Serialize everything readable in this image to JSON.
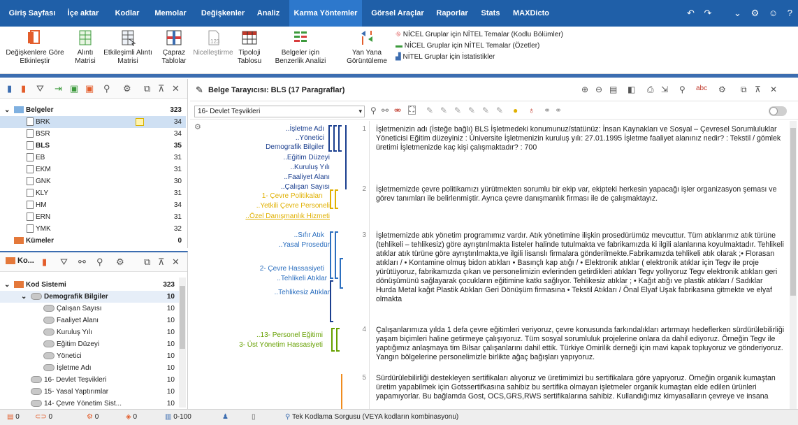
{
  "menu": {
    "tabs": [
      "Giriş Sayfası",
      "İçe aktar",
      "Kodlar",
      "Memolar",
      "Değişkenler",
      "Analiz",
      "Karma Yöntemler",
      "Görsel Araçlar",
      "Raporlar",
      "Stats",
      "MAXDicto"
    ],
    "active_index": 6
  },
  "ribbon": {
    "buttons": [
      {
        "label1": "Değişkenlere Göre",
        "label2": "Etkinleştir",
        "icon": "activate-by-variables-icon"
      },
      {
        "label1": "Alıntı",
        "label2": "Matrisi",
        "icon": "quote-matrix-icon"
      },
      {
        "label1": "Etkileşimli Alıntı",
        "label2": "Matrisi",
        "icon": "interactive-quote-matrix-icon"
      },
      {
        "label1": "Çapraz",
        "label2": "Tablolar",
        "icon": "crosstab-icon"
      },
      {
        "label1": "Nicelleştirme",
        "label2": "",
        "icon": "quantitize-icon"
      },
      {
        "label1": "Tipoloji",
        "label2": "Tablosu",
        "icon": "typology-table-icon"
      },
      {
        "label1": "Belgeler için",
        "label2": "Benzerlik Analizi",
        "icon": "similarity-analysis-icon"
      },
      {
        "label1": "Yan Yana",
        "label2": "Görüntüleme",
        "icon": "side-by-side-icon"
      }
    ],
    "list": [
      "NİCEL Gruplar için NİTEL Temalar (Kodlu Bölümler)",
      "NİCEL Gruplar için NİTEL Temalar (Özetler)",
      "NİTEL Gruplar için İstatistikler"
    ]
  },
  "documents": {
    "root": {
      "label": "Belgeler",
      "count": "323"
    },
    "items": [
      {
        "label": "BRK",
        "count": "34",
        "selected": true
      },
      {
        "label": "BSR",
        "count": "34"
      },
      {
        "label": "BLS",
        "count": "35",
        "bold": true
      },
      {
        "label": "EB",
        "count": "31"
      },
      {
        "label": "EKM",
        "count": "31"
      },
      {
        "label": "GNK",
        "count": "30"
      },
      {
        "label": "KLY",
        "count": "31"
      },
      {
        "label": "HM",
        "count": "34"
      },
      {
        "label": "ERN",
        "count": "31"
      },
      {
        "label": "YMK",
        "count": "32"
      }
    ],
    "sets": {
      "label": "Kümeler",
      "count": "0"
    }
  },
  "codes": {
    "toolbar_title": "Ko...",
    "root": {
      "label": "Kod Sistemi",
      "count": "323"
    },
    "items": [
      {
        "label": "Demografik Bilgiler",
        "count": "10",
        "level": 1,
        "bold": true
      },
      {
        "label": "Çalışan Sayısı",
        "count": "10",
        "level": 2
      },
      {
        "label": "Faaliyet Alanı",
        "count": "10",
        "level": 2
      },
      {
        "label": "Kuruluş Yılı",
        "count": "10",
        "level": 2
      },
      {
        "label": "Eğitim Düzeyi",
        "count": "10",
        "level": 2
      },
      {
        "label": "Yönetici",
        "count": "10",
        "level": 2
      },
      {
        "label": "İşletme Adı",
        "count": "10",
        "level": 2
      },
      {
        "label": "16- Devlet Teşvikleri",
        "count": "10",
        "level": 1
      },
      {
        "label": "15- Yasal Yaptırımlar",
        "count": "10",
        "level": 1
      },
      {
        "label": "14- Çevre Yönetim Sist...",
        "count": "10",
        "level": 1
      }
    ]
  },
  "browser": {
    "title": "Belge Tarayıcısı: BLS  (17 Paragraflar)",
    "select_value": "16- Devlet Teşvikleri",
    "code_labels": [
      {
        "text": "..İşletme Adı",
        "color": "#1b3f8f"
      },
      {
        "text": "..Yönetici",
        "color": "#1b3f8f"
      },
      {
        "text": "Demografik Bilgiler",
        "color": "#1b3f8f"
      },
      {
        "text": "..Eğitim Düzeyi",
        "color": "#1b3f8f"
      },
      {
        "text": "..Kuruluş Yılı",
        "color": "#1b3f8f"
      },
      {
        "text": "..Faaliyet Alanı",
        "color": "#1b3f8f"
      },
      {
        "text": "..Çalışan Sayısı",
        "color": "#1b3f8f"
      },
      {
        "text": "1- Çevre Politikaları",
        "color": "#e0b000"
      },
      {
        "text": "..Yetkili Çevre Personeli",
        "color": "#e0b000"
      },
      {
        "text": "..Özel Danışmanlık Hizmeti",
        "color": "#e0b000"
      },
      {
        "text": "..Sıfır Atık",
        "color": "#2c6fbf"
      },
      {
        "text": "..Yasal Prosedür",
        "color": "#2c6fbf"
      },
      {
        "text": "2- Çevre Hassasiyeti",
        "color": "#2c6fbf"
      },
      {
        "text": "..Tehlikeli Atıklar",
        "color": "#2c6fbf"
      },
      {
        "text": "..Tehlikesiz Atıklar",
        "color": "#2c6fbf"
      },
      {
        "text": "..13- Personel Eğitimi",
        "color": "#66a000"
      },
      {
        "text": "3- Üst Yönetim Hassasiyeti",
        "color": "#66a000"
      }
    ],
    "paragraphs": [
      {
        "num": "1",
        "text": " İşletmenizin adı (İsteğe bağlı) BLS İşletmedeki konumunuz/statünüz: İnsan Kaynakları ve Sosyal – Çevresel Sorumluluklar Yöneticisi Eğitim düzeyiniz : Üniversite İşletmenizin kuruluş yılı: 27.01.1995 İşletme faaliyet alanınız nedir? : Tekstil / gömlek üretimi İşletmenizde kaç kişi çalışmaktadır? : 700"
      },
      {
        "num": "2",
        "text": "İşletmemizde çevre politikamızı yürütmekten sorumlu bir ekip var, ekipteki herkesin yapacağı işler organizasyon şeması ve görev tanımları ile belirlenmiştir. Ayrıca çevre danışmanlık firması ile de çalışmaktayız."
      },
      {
        "num": "3",
        "text": "İşletmemizde atık yönetim programımız vardır. Atık yönetimine ilişkin prosedürümüz mevcuttur. Tüm atıklarımız atık türüne (tehlikeli – tehlikesiz) göre ayrıştırılmakta  listeler halinde tutulmakta ve fabrikamızda ki ilgili alanlarına koyulmaktadır. Tehlikeli atıklar atık türüne göre ayrıştırılmakta,ve ilgili lisanslı firmalara gönderilmekte.Fabrikamızda tehlikeli atık olarak ;• Florasan atıkları /  • Kontamine olmuş bidon atıkları   • Basınçlı kap atığı / • Elektronik atıklar ( elektronik atıklar için Tegv ile proje yürütüyoruz, fabrikamızda çıkan ve personelimizin evlerinden getirdikleri atıkları Tegv yollıyoruz Tegv elektronik atıkları geri dönüşümünü sağlayarak çocukların eğitimine katkı sağlıyor. Tehlikesiz atıklar ; •       Kağıt atığı ve plastik atıkları / Sadıklar Hurda Metal kağıt Plastik Atıkları Geri Dönüşüm firmasına • Tekstil Atıkları / Önal Elyaf Uşak fabrikasına gitmekte ve elyaf olmakta"
      },
      {
        "num": "4",
        "text": " Çalışanlarımıza yılda 1 defa çevre eğitimleri veriyoruz, çevre konusunda farkındalıkları artırmayı hedeflerken sürdürülebilirliği yaşam biçimleri haline getirmeye çalışıyoruz. Tüm sosyal sorumluluk projelerine onlara da dahil ediyoruz. Örneğin Tegv ile yaptığımız anlaşmaya tim Bilsar çalışanlarını dahil ettik. Türkiye Omirilik derneği için mavi kapak topluyoruz ve gönderiyoruz. Yangın bölgelerine personelimizle birlikte ağaç bağışları yapıyoruz."
      },
      {
        "num": "5",
        "text": "Sürdürülebilirliği destekleyen sertifikaları alıyoruz ve üretimimizi bu sertifikalara göre yapıyoruz. Örneğin organik kumaştan üretim yapabilmek için Gotssertifkasına sahibiz bu sertifika olmayan işletmeler organik kumaştan elde edilen ürünleri yapamıyorlar. Bu bağlamda Gost, OCS,GRS,RWS  sertifikalarına sahibiz. Kullandığımız kimyasalların çevreye ve insana"
      }
    ]
  },
  "status": {
    "items": [
      "0",
      "0",
      "0",
      "0",
      "0-100"
    ],
    "query": "Tek Kodlama Sorgusu (VEYA kodların kombinasyonu)"
  },
  "colors": {
    "menubar": "#1f5fa8",
    "accent": "#3c6db0",
    "cevre_politikalari": "#e0b000",
    "cevre_hassasiyeti": "#2c6fbf",
    "ust_yonetim": "#66a000",
    "orange_bracket": "#f08c1e"
  }
}
